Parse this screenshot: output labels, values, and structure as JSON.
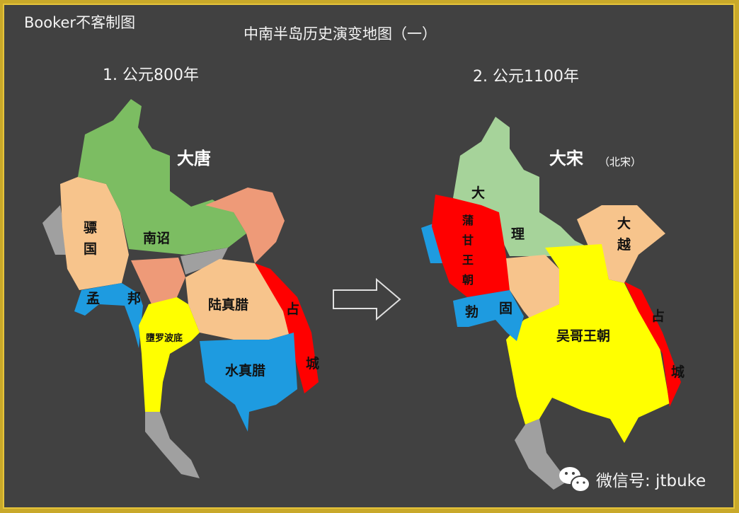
{
  "credit": "Booker不客制图",
  "title": "中南半岛历史演变地图（一）",
  "map1": {
    "heading": "1. 公元800年",
    "empire": "大唐",
    "regions": [
      {
        "name": "骠国",
        "color": "#f7c48c"
      },
      {
        "name": "南诏",
        "color": "#7cbd62"
      },
      {
        "name": "孟邦",
        "color": "#1e9be0"
      },
      {
        "name": "墮罗波底",
        "color": "#ffff00"
      },
      {
        "name": "陆真腊",
        "color": "#f7c48c"
      },
      {
        "name": "水真腊",
        "color": "#1e9be0"
      },
      {
        "name": "占城",
        "color": "#ff0000"
      }
    ]
  },
  "map2": {
    "heading": "2. 公元1100年",
    "empire": "大宋",
    "empire_note": "（北宋）",
    "regions": [
      {
        "name": "大理",
        "color": "#a6d39a"
      },
      {
        "name": "蒲甘王朝",
        "color": "#ff0000"
      },
      {
        "name": "勃固",
        "color": "#1e9be0"
      },
      {
        "name": "大越",
        "color": "#f7c48c"
      },
      {
        "name": "吴哥王朝",
        "color": "#ffff00"
      },
      {
        "name": "占城",
        "color": "#ff0000"
      }
    ]
  },
  "legend": {
    "arrow": "right-arrow"
  },
  "watermark": {
    "icon": "wechat-icon",
    "text": "微信号: jtbuke"
  }
}
